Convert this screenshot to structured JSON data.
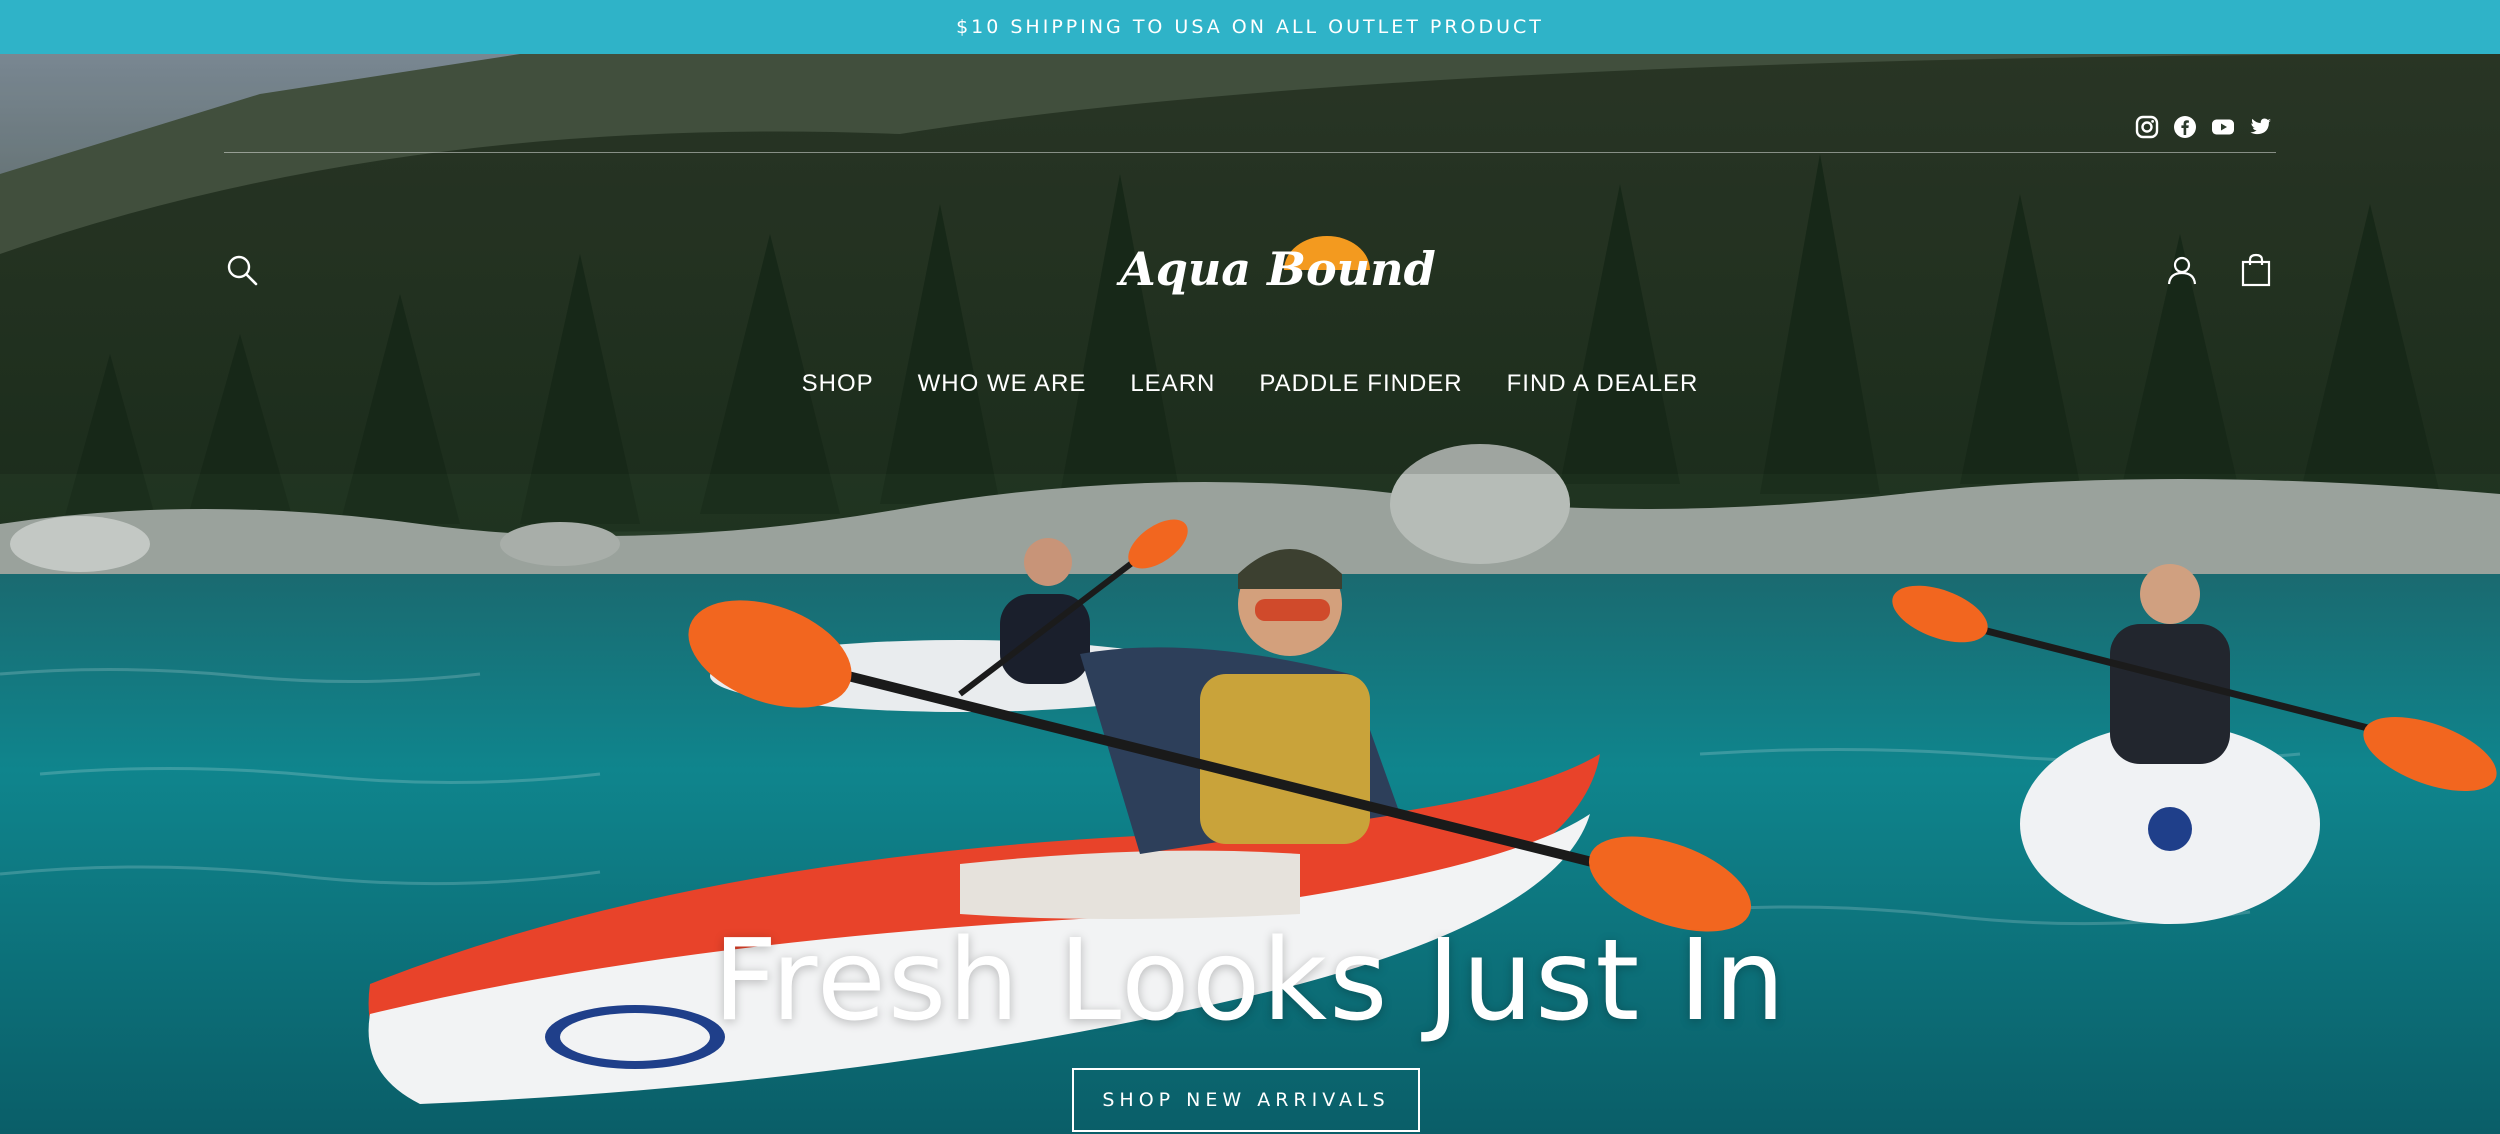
{
  "announcement": {
    "text": "$10 SHIPPING TO USA ON ALL OUTLET PRODUCT"
  },
  "social": [
    {
      "name": "instagram",
      "icon": "instagram-icon"
    },
    {
      "name": "facebook",
      "icon": "facebook-icon"
    },
    {
      "name": "youtube",
      "icon": "youtube-icon"
    },
    {
      "name": "twitter",
      "icon": "twitter-icon"
    }
  ],
  "header": {
    "logo_text": "Aqua Bound",
    "search_icon": "search-icon",
    "account_icon": "account-icon",
    "cart_icon": "cart-icon"
  },
  "nav": {
    "items": [
      "SHOP",
      "WHO WE ARE",
      "LEARN",
      "PADDLE FINDER",
      "FIND A DEALER"
    ]
  },
  "hero": {
    "headline": "Fresh Looks Just In",
    "cta_label": "SHOP NEW ARRIVALS",
    "slides": 2,
    "active_slide": 2
  },
  "colors": {
    "announcement_bg": "#2fb3c8",
    "logo_sun": "#f39a1f",
    "kayak_red": "#e8432a",
    "water": "#0f7c86"
  }
}
